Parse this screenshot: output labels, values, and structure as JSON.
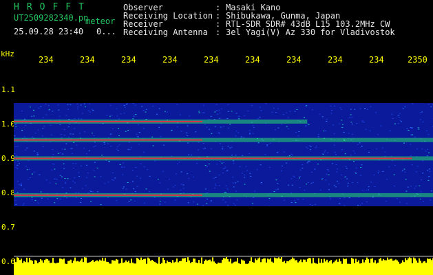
{
  "app": {
    "title_letters": "HROFFT",
    "filename": "UT2509282340.pn",
    "mode": "meteor",
    "date_time": "25.09.28 23:40",
    "extra": "0..."
  },
  "info": {
    "observer_label": "Observer",
    "observer_value": "Masaki Kano",
    "location_label": "Receiving Location",
    "location_value": "Shibukawa, Gunma, Japan",
    "receiver_label": "Receiver",
    "receiver_value": "RTL-SDR SDR# 43dB L15 103.2MHz CW",
    "antenna_label": "Receiving Antenna",
    "antenna_value": "3el Yagi(V) Az 330 for Vladivostok",
    "colon": ":"
  },
  "axis": {
    "unit": "kHz",
    "x_ticks": [
      "234",
      "234",
      "234",
      "234",
      "234",
      "234",
      "234",
      "234",
      "234",
      "2350"
    ],
    "y_ticks": [
      "1.1",
      "1.0",
      "0.9",
      "0.8",
      "0.7",
      "0.6"
    ]
  },
  "colors": {
    "background": "#000000",
    "text_green": "#22c55e",
    "text_yellow": "#ffff00",
    "signal_red": "#ff2040",
    "signal_green": "#28e070",
    "noise_blue": "#1830c0"
  },
  "chart_data": {
    "type": "heatmap",
    "ylabel": "kHz",
    "ylim": [
      0.6,
      1.1
    ],
    "x_ticks": [
      "234",
      "234",
      "234",
      "234",
      "234",
      "234",
      "234",
      "234",
      "234",
      "2350"
    ],
    "y_ticks": [
      "1.1",
      "1.0",
      "0.9",
      "0.8",
      "0.7",
      "0.6"
    ],
    "signal_bands_khz": [
      1.0,
      0.95,
      0.9,
      0.8
    ],
    "noise_band_khz": [
      0.77,
      1.05
    ],
    "bottom_bar": "amplitude"
  }
}
